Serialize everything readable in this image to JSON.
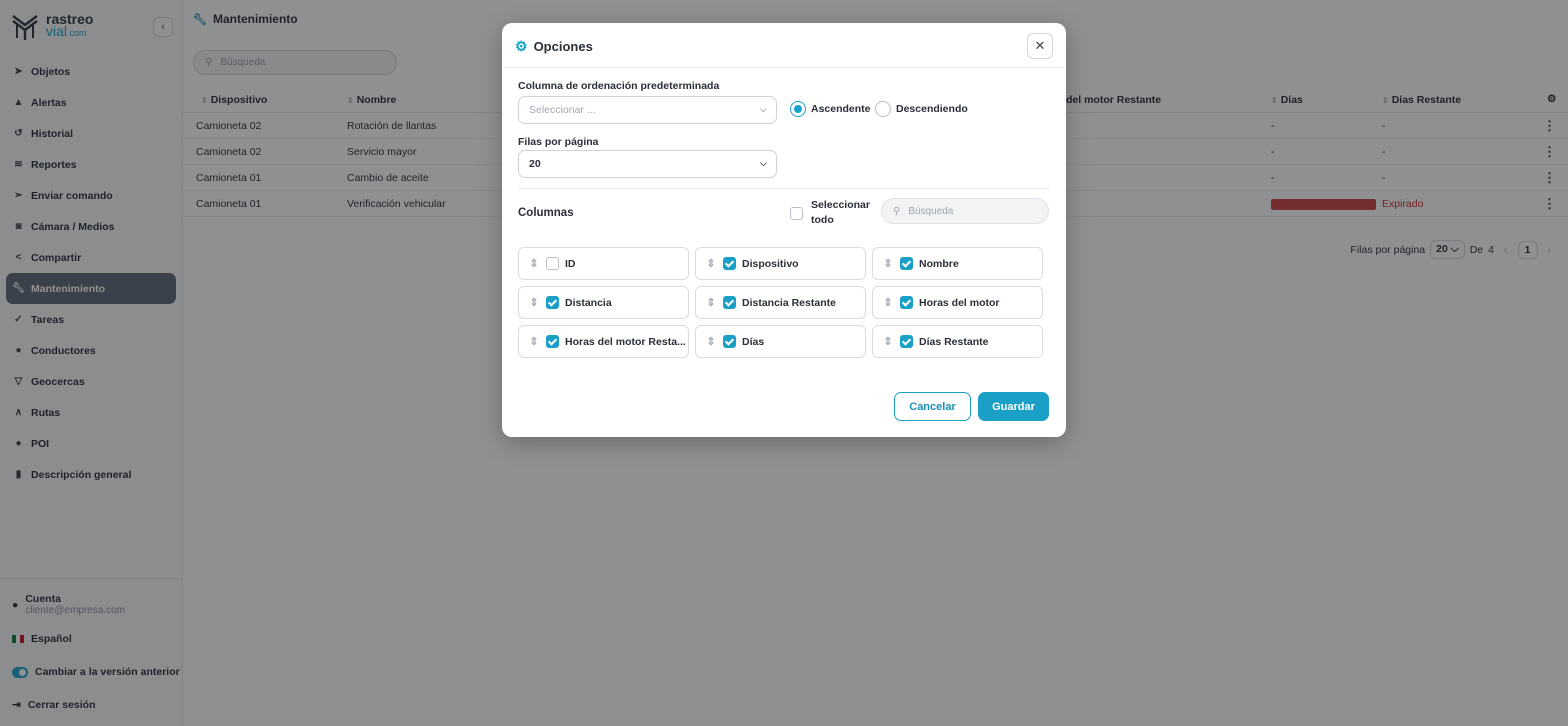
{
  "brand": {
    "line1": "rastreo",
    "line2": "vial",
    "line2_suffix": ".com"
  },
  "sidebar": {
    "items": [
      {
        "label": "Objetos",
        "icon": "navigation-arrow-icon"
      },
      {
        "label": "Alertas",
        "icon": "bell-icon"
      },
      {
        "label": "Historial",
        "icon": "history-icon"
      },
      {
        "label": "Reportes",
        "icon": "layers-icon"
      },
      {
        "label": "Enviar comando",
        "icon": "send-icon"
      },
      {
        "label": "Cámara / Medios",
        "icon": "camera-icon"
      },
      {
        "label": "Compartir",
        "icon": "share-icon"
      },
      {
        "label": "Mantenimiento",
        "icon": "wrench-icon",
        "active": true
      },
      {
        "label": "Tareas",
        "icon": "check-icon"
      },
      {
        "label": "Conductores",
        "icon": "users-icon"
      },
      {
        "label": "Geocercas",
        "icon": "geofence-icon"
      },
      {
        "label": "Rutas",
        "icon": "route-icon"
      },
      {
        "label": "POI",
        "icon": "pin-icon"
      },
      {
        "label": "Descripción general",
        "icon": "bar-chart-icon"
      }
    ],
    "account": {
      "label": "Cuenta",
      "email": "cliente@empresa.com"
    },
    "language": "Español",
    "switch_label": "Cambiar a la versión anterior",
    "logout": "Cerrar sesión"
  },
  "header": {
    "title": "Mantenimiento"
  },
  "search": {
    "placeholder": "Búsqueda"
  },
  "table": {
    "columns": [
      "Dispositivo",
      "Nombre",
      "del motor Restante",
      "Días",
      "Días Restante"
    ],
    "rows": [
      {
        "device": "Camioneta 02",
        "name": "Rotación de llantas",
        "days": "-",
        "remaining": "-"
      },
      {
        "device": "Camioneta 02",
        "name": "Servicio mayor",
        "days": "-",
        "remaining": "-"
      },
      {
        "device": "Camioneta 01",
        "name": "Cambio de aceite",
        "days": "-",
        "remaining": "-"
      },
      {
        "device": "Camioneta 01",
        "name": "Verificación vehicular",
        "days": "",
        "remaining": "Expirado",
        "days_progress": 1.0
      }
    ]
  },
  "pagination": {
    "rows_label": "Filas por página",
    "rows_value": "20",
    "of_label": "De",
    "total": "4",
    "current": "1"
  },
  "modal": {
    "title": "Opciones",
    "sort_label": "Columna de ordenación predeterminada",
    "sort_placeholder": "Seleccionar ...",
    "asc": "Ascendente",
    "desc": "Descendiendo",
    "rows_label": "Filas por página",
    "rows_value": "20",
    "columns_title": "Columnas",
    "select_all_1": "Seleccionar",
    "select_all_2": "todo",
    "col_search_placeholder": "Búsqueda",
    "columns": [
      {
        "label": "ID",
        "checked": false
      },
      {
        "label": "Dispositivo",
        "checked": true
      },
      {
        "label": "Nombre",
        "checked": true
      },
      {
        "label": "Distancia",
        "checked": true
      },
      {
        "label": "Distancia Restante",
        "checked": true
      },
      {
        "label": "Horas del motor",
        "checked": true
      },
      {
        "label": "Horas del motor Resta...",
        "checked": true
      },
      {
        "label": "Días",
        "checked": true
      },
      {
        "label": "Días Restante",
        "checked": true
      }
    ],
    "cancel": "Cancelar",
    "save": "Guardar"
  },
  "colors": {
    "accent": "#1aa0c6",
    "expired": "#d12c2c",
    "active_nav": "#5d6877"
  }
}
